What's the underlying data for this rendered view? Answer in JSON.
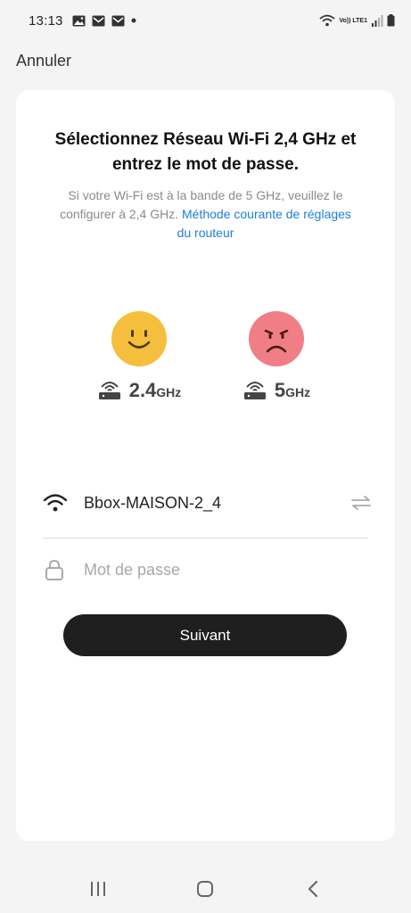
{
  "status_bar": {
    "time": "13:13",
    "left_icons": [
      "gallery-icon",
      "mail-icon",
      "mail-icon",
      "dot-icon"
    ],
    "right_icons": [
      "wifi-icon",
      "volte-icon",
      "signal-icon",
      "battery-icon"
    ],
    "volte_text": "Vo)) LTE1"
  },
  "header": {
    "cancel_label": "Annuler"
  },
  "card": {
    "title": "Sélectionnez Réseau Wi-Fi 2,4 GHz et entrez le mot de passe.",
    "subtitle_text": "Si votre Wi-Fi est à  la bande de 5 GHz, veuillez le configurer à 2,4 GHz.",
    "subtitle_link": "Méthode courante de réglages du routeur",
    "bands": [
      {
        "number": "2.4",
        "unit": "GHz",
        "status": "supported",
        "face_color": "#f5be3c"
      },
      {
        "number": "5",
        "unit": "GHz",
        "status": "unsupported",
        "face_color": "#f07e87"
      }
    ],
    "ssid": "Bbox-MAISON-2_4",
    "password_placeholder": "Mot de passe",
    "next_label": "Suivant"
  },
  "nav": {
    "buttons": [
      "recent-apps-icon",
      "home-icon",
      "back-icon"
    ]
  },
  "colors": {
    "background": "#f4f4f4",
    "card": "#ffffff",
    "link": "#1e7fd6",
    "button": "#1f1f1f"
  }
}
